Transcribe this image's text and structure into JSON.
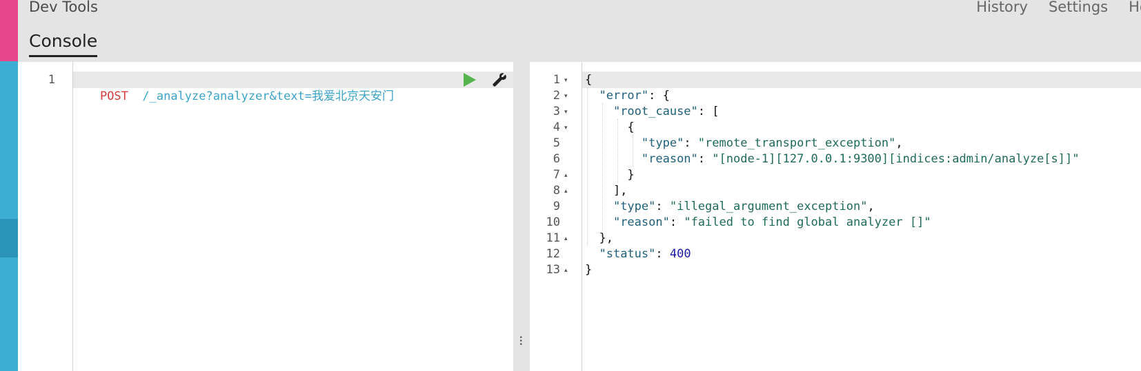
{
  "app": {
    "title": "Dev Tools"
  },
  "top_nav": {
    "history": "History",
    "settings": "Settings",
    "help": "Help"
  },
  "tabs": {
    "console": "Console"
  },
  "request": {
    "line_number": "1",
    "method": "POST",
    "url": "/_analyze?analyzer&text=我爱北京天安门"
  },
  "response": {
    "lines": [
      {
        "no": "1",
        "fold": "▾"
      },
      {
        "no": "2",
        "fold": "▾"
      },
      {
        "no": "3",
        "fold": "▾"
      },
      {
        "no": "4",
        "fold": "▾"
      },
      {
        "no": "5",
        "fold": ""
      },
      {
        "no": "6",
        "fold": ""
      },
      {
        "no": "7",
        "fold": "▴"
      },
      {
        "no": "8",
        "fold": "▴"
      },
      {
        "no": "9",
        "fold": ""
      },
      {
        "no": "10",
        "fold": ""
      },
      {
        "no": "11",
        "fold": "▴"
      },
      {
        "no": "12",
        "fold": ""
      },
      {
        "no": "13",
        "fold": "▴"
      }
    ],
    "tokens": {
      "open_brace": "{",
      "error_key": "\"error\"",
      "root_cause_key": "\"root_cause\"",
      "type_key": "\"type\"",
      "type_value_1": "\"remote_transport_exception\"",
      "reason_key": "\"reason\"",
      "reason_value_1": "\"[node-1][127.0.0.1:9300][indices:admin/analyze[s]]\"",
      "type_value_2": "\"illegal_argument_exception\"",
      "reason_value_2": "\"failed to find global analyzer []\"",
      "status_key": "\"status\"",
      "status_value": "400"
    }
  },
  "colors": {
    "nav_blue": "#3caed2",
    "nav_pink": "#e8488b",
    "run_green": "#54b44e",
    "method_red": "#d43b3b",
    "url_blue": "#3ba2c7"
  },
  "icons": {
    "run": "play-icon",
    "settings": "wrench-icon",
    "resize": "vertical-dots-icon"
  }
}
